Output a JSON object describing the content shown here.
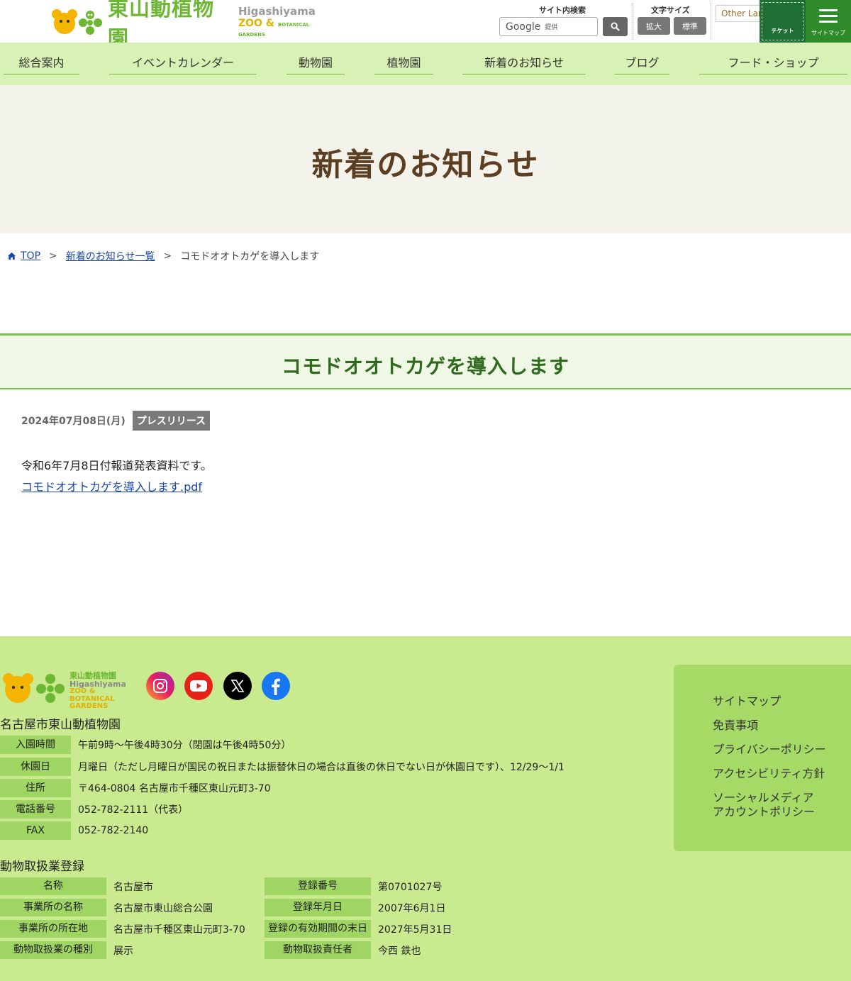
{
  "header": {
    "logo_ja": "東山動植物園",
    "logo_en1": "Higashiyama",
    "logo_en2": "ZOO &",
    "logo_en3": "BOTANICAL GARDENS",
    "search_label": "サイト内検索",
    "search_provider": "Google",
    "search_provider_suffix": "提供",
    "font_size_label": "文字サイズ",
    "font_size_large": "拡大",
    "font_size_normal": "標準",
    "language": "Other Languages",
    "ticket": "チケット",
    "sitemap": "サイトマップ"
  },
  "nav": {
    "items": [
      "総合案内",
      "イベントカレンダー",
      "動物園",
      "植物園",
      "新着のお知らせ",
      "ブログ",
      "フード・ショップ"
    ]
  },
  "hero": {
    "title": "新着のお知らせ"
  },
  "breadcrumb": {
    "home": "TOP",
    "list": "新着のお知らせ一覧",
    "sep": ">",
    "current": "コモドオオトカゲを導入します"
  },
  "article": {
    "title": "コモドオオトカゲを導入します",
    "date": "2024年07月08日(月)",
    "tag": "プレスリリース",
    "body": "令和6年7月8日付報道発表資料です。",
    "link": "コモドオオトカゲを導入します.pdf"
  },
  "footer": {
    "logo_t1": "東山動植物園",
    "logo_t2": "Higashiyama",
    "logo_t3": "ZOO & BOTANICAL GARDENS",
    "name": "名古屋市東山動植物園",
    "info": [
      {
        "label": "入園時間",
        "value": "午前9時～午後4時30分（閉園は午後4時50分）"
      },
      {
        "label": "休園日",
        "value": "月曜日（ただし月曜日が国民の祝日または振替休日の場合は直後の休日でない日が休園日です）、12/29～1/1"
      },
      {
        "label": "住所",
        "value": "〒464-0804 名古屋市千種区東山元町3-70"
      },
      {
        "label": "電話番号",
        "value": "052-782-2111（代表）"
      },
      {
        "label": "FAX",
        "value": "052-782-2140"
      }
    ],
    "reg_title": "動物取扱業登録",
    "reg_left": [
      {
        "label": "名称",
        "value": "名古屋市"
      },
      {
        "label": "事業所の名称",
        "value": "名古屋市東山総合公園"
      },
      {
        "label": "事業所の所在地",
        "value": "名古屋市千種区東山元町3-70"
      },
      {
        "label": "動物取扱業の種別",
        "value": "展示"
      }
    ],
    "reg_right": [
      {
        "label": "登録番号",
        "value": "第0701027号"
      },
      {
        "label": "登録年月日",
        "value": "2007年6月1日"
      },
      {
        "label": "登録の有効期間の末日",
        "value": "2027年5月31日"
      },
      {
        "label": "動物取扱責任者",
        "value": "今西 鉄也"
      }
    ],
    "links": [
      "サイトマップ",
      "免責事項",
      "プライバシーポリシー",
      "アクセシビリティ方針",
      "ソーシャルメディア",
      "アカウントポリシー"
    ]
  },
  "icons": {
    "instagram": "instagram-icon",
    "youtube": "youtube-icon",
    "x": "x-icon",
    "facebook": "facebook-icon",
    "search": "search-icon",
    "home": "home-icon",
    "menu": "hamburger-menu-icon"
  },
  "colors": {
    "nav_bg": "#d8f2b5",
    "footer_bg": "#c9ea8f",
    "title_green": "#2f6a1e",
    "hero_brown": "#5c3f22",
    "link_blue": "#1a47a8"
  }
}
